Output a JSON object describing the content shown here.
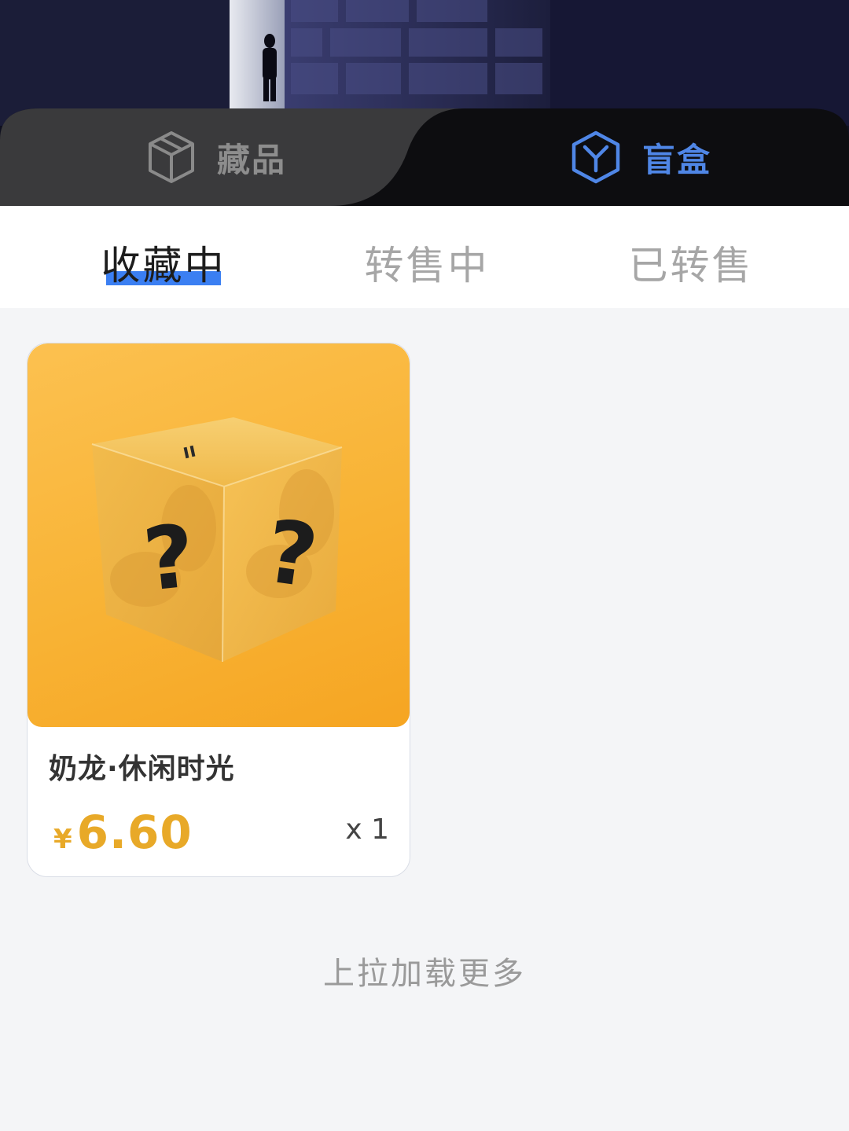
{
  "segment_tabs": {
    "collection_label": "藏品",
    "blindbox_label": "盲盒",
    "active": "盲盒"
  },
  "sub_tabs": [
    {
      "label": "收藏中",
      "active": true
    },
    {
      "label": "转售中",
      "active": false
    },
    {
      "label": "已转售",
      "active": false
    }
  ],
  "items": [
    {
      "title": "奶龙·休闲时光",
      "currency": "¥",
      "price": "6.60",
      "quantity": "x 1"
    }
  ],
  "footer": {
    "load_more": "上拉加载更多"
  },
  "colors": {
    "accent": "#3b7ff2",
    "active_segment": "#4f86e6",
    "price": "#e8a928",
    "card_bg": "#f8b335"
  }
}
